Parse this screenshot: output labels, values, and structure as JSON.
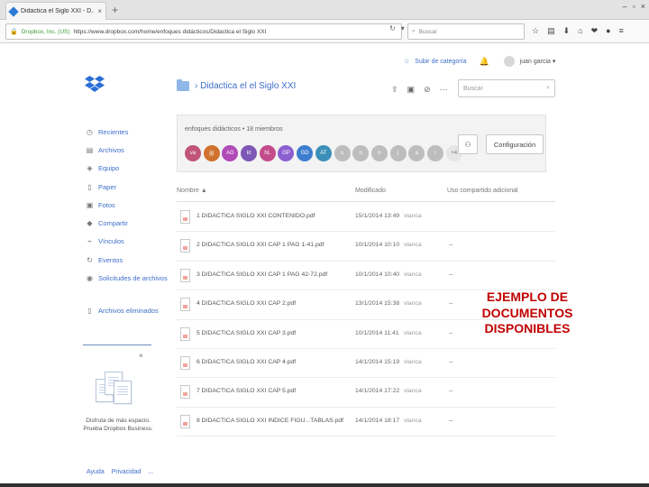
{
  "browser": {
    "tab_title": "Didactica el Siglo XXI - D...",
    "tab_close": "×",
    "new_tab": "+",
    "window_controls": [
      "–",
      "▫",
      "×"
    ],
    "lock_icon": "🔒",
    "site_identity": "Dropbox, Inc. (US)",
    "url": "https://www.dropbox.com/home/enfoques didácticos/Didactica el Siglo XXI",
    "url_icons": [
      "↻",
      "▾"
    ],
    "search_placeholder": "Buscar",
    "toolbar_icons": [
      "☆",
      "▤",
      "⬇",
      "⌂",
      "❤",
      "●",
      "≡"
    ]
  },
  "app": {
    "upgrade_link": "Subir de categoría",
    "user_name": "juan garcia ▾",
    "breadcrumb": "› Didactica el el Siglo XXI",
    "action_icons": [
      "⇪",
      "▣",
      "⊘",
      "⋯"
    ],
    "search_placeholder": "Buscar",
    "search_icon": "⌕"
  },
  "sidebar": {
    "items": [
      {
        "label": "Recientes",
        "icon": "◷"
      },
      {
        "label": "Archivos",
        "icon": "▤"
      },
      {
        "label": "Equipo",
        "icon": "◈"
      },
      {
        "label": "Paper",
        "icon": "▯"
      },
      {
        "label": "Fotos",
        "icon": "▣"
      },
      {
        "label": "Compartir",
        "icon": "◆"
      },
      {
        "label": "Vínculos",
        "icon": "⌁"
      },
      {
        "label": "Eventos",
        "icon": "↻"
      },
      {
        "label": "Solicitudes de archivos",
        "icon": "◉"
      }
    ],
    "deleted": {
      "label": "Archivos eliminados",
      "icon": "▯"
    }
  },
  "promo": {
    "close": "×",
    "text": "Disfruta de más espacio. Prueba Dropbox Business.",
    "links": [
      "Ayuda",
      "Privacidad",
      "..."
    ]
  },
  "team": {
    "title": "enfoques didácticos • 18 miembros",
    "members": [
      {
        "initials": "va",
        "color": "#c0547a"
      },
      {
        "initials": "jg",
        "color": "#d0722e"
      },
      {
        "initials": "AG",
        "color": "#b04bb8"
      },
      {
        "initials": "kt",
        "color": "#7d58b6"
      },
      {
        "initials": "hL",
        "color": "#c44c8c"
      },
      {
        "initials": "GP",
        "color": "#8c5fd0"
      },
      {
        "initials": "GD",
        "color": "#3c7dd0"
      },
      {
        "initials": "AT",
        "color": "#3c8fb8"
      },
      {
        "initials": "s",
        "color": "#bdbdbd"
      },
      {
        "initials": "o",
        "color": "#bdbdbd"
      },
      {
        "initials": "n",
        "color": "#bdbdbd"
      },
      {
        "initials": "j",
        "color": "#bdbdbd"
      },
      {
        "initials": "a",
        "color": "#bdbdbd"
      },
      {
        "initials": "i",
        "color": "#bdbdbd"
      },
      {
        "initials": "+4",
        "color": "#e6e6e6"
      }
    ],
    "add_member_icon": "⚇",
    "config_label": "Configuración"
  },
  "table": {
    "headers": {
      "name": "Nombre ▲",
      "modified": "Modificado",
      "comment": "Uso compartido adicional"
    },
    "rows": [
      {
        "name": "1 DIDACTICA SIGLO XXI CONTENIDO.pdf",
        "date": "15/1/2014 13:49",
        "user": "vianca",
        "comment": ""
      },
      {
        "name": "2 DIDACTICA SIGLO XXI CAP 1 PAG 1-41.pdf",
        "date": "10/1/2014 10:10",
        "user": "vianca",
        "comment": "--"
      },
      {
        "name": "3 DIDACTICA SIGLO XXI CAP 1 PAG 42-72.pdf",
        "date": "10/1/2014 10:40",
        "user": "vianca",
        "comment": "--"
      },
      {
        "name": "4 DIDACTICA SIGLO XXI CAP 2.pdf",
        "date": "13/1/2014 15:38",
        "user": "vianca",
        "comment": "--"
      },
      {
        "name": "5 DIDACTICA SIGLO XXI CAP 3.pdf",
        "date": "10/1/2014 11:41",
        "user": "vianca",
        "comment": "--"
      },
      {
        "name": "6 DIDACTICA SIGLO XXI CAP 4.pdf",
        "date": "14/1/2014 15:19",
        "user": "vianca",
        "comment": "--"
      },
      {
        "name": "7 DIDACTICA SIGLO XXI CAP 5.pdf",
        "date": "14/1/2014 17:22",
        "user": "vianca",
        "comment": "--"
      },
      {
        "name": "8 DIDACTICA SIGLO XXI INDICE FIGU...TABLAS.pdf",
        "date": "14/1/2014 18:17",
        "user": "vianca",
        "comment": "--"
      }
    ]
  },
  "callout": {
    "lines": [
      "EJEMPLO DE",
      "DOCUMENTOS",
      "DISPONIBLES"
    ],
    "color": "#c00000"
  }
}
